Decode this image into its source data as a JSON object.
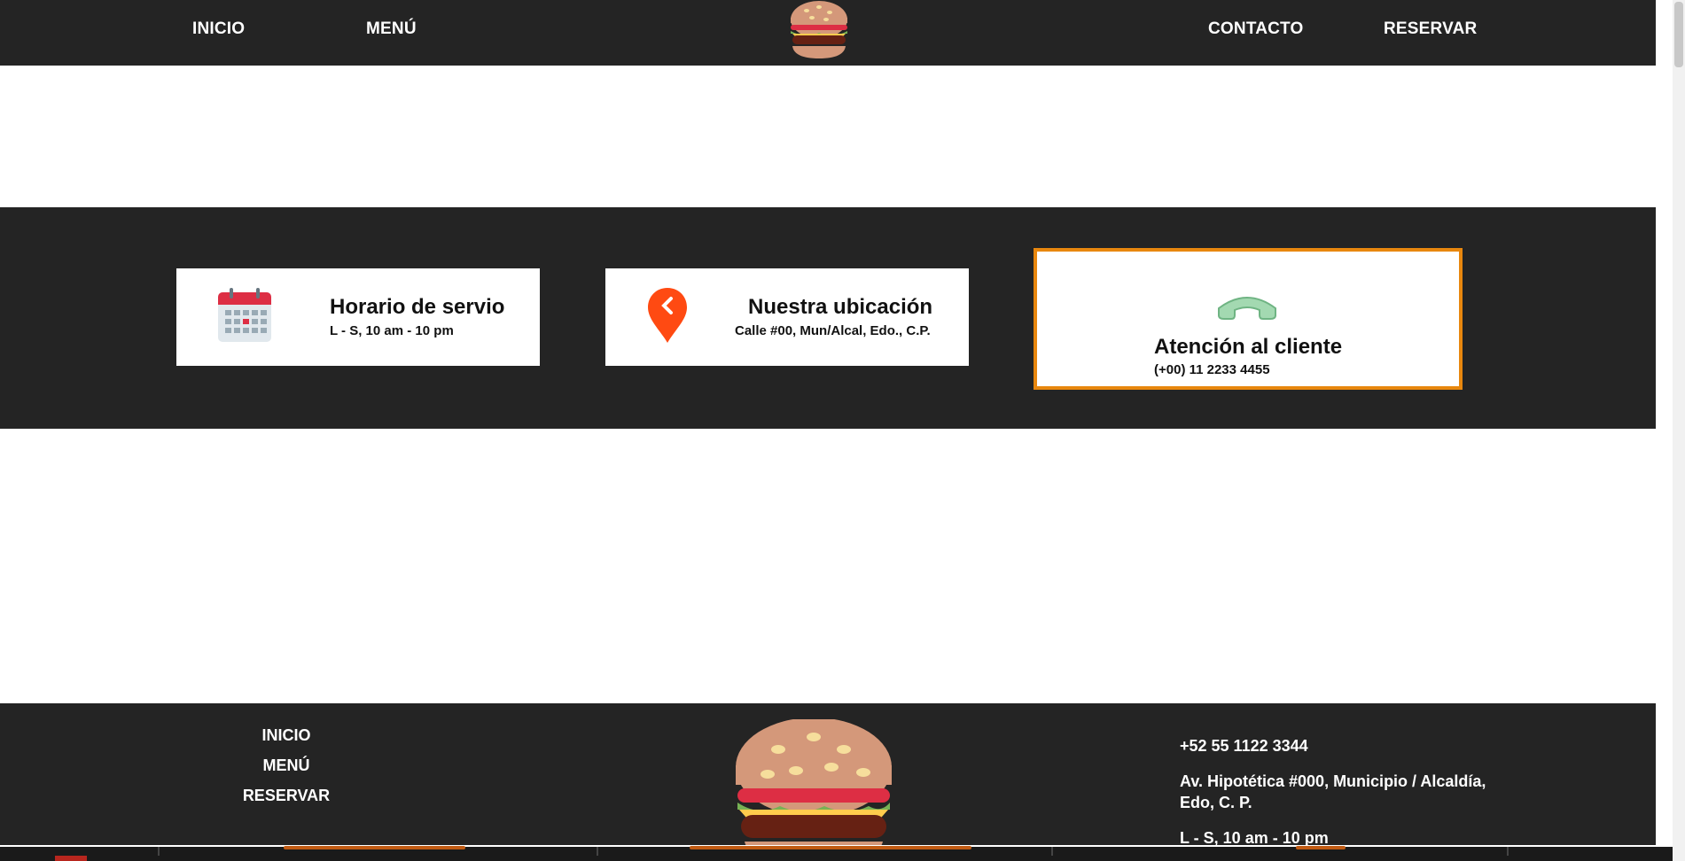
{
  "header": {
    "nav_left": [
      "INICIO",
      "MENÚ"
    ],
    "nav_right": [
      "CONTACTO",
      "RESERVAR"
    ],
    "logo_icon": "burger-icon"
  },
  "info_cards": [
    {
      "icon": "calendar-icon",
      "title": "Horario de servio",
      "subtitle": "L - S, 10 am - 10 pm"
    },
    {
      "icon": "location-pin-icon",
      "title": "Nuestra ubicación",
      "subtitle": "Calle #00, Mun/Alcal, Edo., C.P."
    },
    {
      "icon": "phone-icon",
      "title": "Atención al cliente",
      "subtitle": "(+00) 11 2233 4455"
    }
  ],
  "footer": {
    "links": [
      "INICIO",
      "MENÚ",
      "RESERVAR"
    ],
    "phone": "+52 55 1122 3344",
    "address_line1": "Av. Hipotética #000, Municipio / Alcaldía,",
    "address_line2": "Edo, C. P.",
    "hours": "L - S, 10 am - 10 pm",
    "logo_icon": "burger-icon"
  },
  "colors": {
    "dark": "#242424",
    "accent_border": "#e8870e",
    "pin": "#ff4a12",
    "phone": "#8fcf9e"
  }
}
